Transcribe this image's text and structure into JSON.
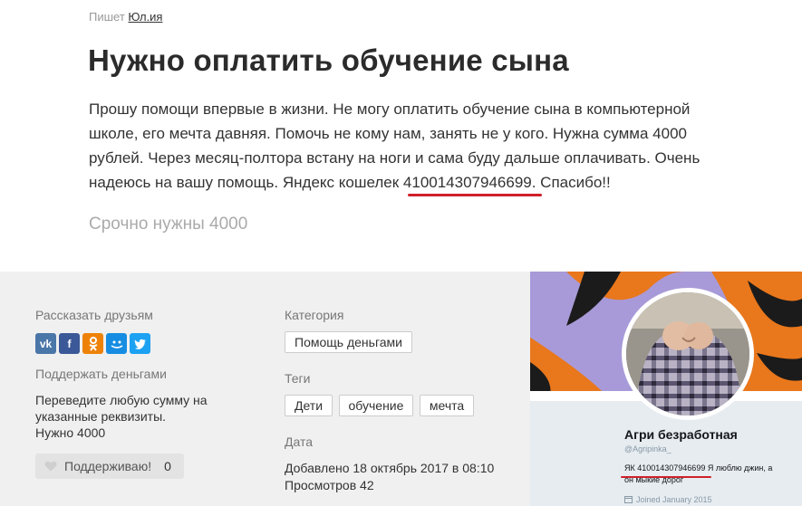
{
  "post": {
    "author_prefix": "Пишет",
    "author_name": "Юл.ия",
    "title": "Нужно оплатить обучение сына",
    "body_before_wallet": "Прошу помощи впервые в жизни. Не могу оплатить обучение сына в компьютерной школе, его мечта давняя. Помочь не кому нам, занять не у кого. Нужна сумма 4000 рублей. Через месяц-полтора встану на ноги и сама буду дальше оплачивать. Очень надеюсь на вашу помощь. Яндекс кошелек ",
    "wallet": "410014307946699",
    "body_after_wallet": ". Спасибо!!",
    "subtitle": "Срочно нужны 4000"
  },
  "sidebar_left": {
    "share_label": "Рассказать друзьям",
    "social": [
      {
        "name": "vk-icon",
        "glyph": "vk"
      },
      {
        "name": "facebook-icon",
        "glyph": "f"
      },
      {
        "name": "odnoklassniki-icon",
        "glyph": "ok"
      },
      {
        "name": "moimir-icon",
        "glyph": "@"
      },
      {
        "name": "twitter-icon",
        "glyph": "t"
      }
    ],
    "money_label": "Поддержать деньгами",
    "money_text_1": "Переведите любую сумму на",
    "money_text_2": "указанные реквизиты.",
    "money_text_3": "Нужно 4000",
    "support_button": "Поддерживаю!",
    "support_count": "0"
  },
  "sidebar_mid": {
    "category_label": "Категория",
    "category": "Помощь деньгами",
    "tags_label": "Теги",
    "tags": [
      "Дети",
      "обучение",
      "мечта"
    ],
    "date_label": "Дата",
    "added": "Добавлено 18 октябрь 2017 в 08:10",
    "views": "Просмотров 42"
  },
  "profile": {
    "name": "Агри безработная",
    "handle": "@Agripinka_",
    "bio_line1": "ЯК 410014307946699 Я люблю джин, а",
    "bio_line2": "он мыкие дорог",
    "joined": "Joined January 2015"
  }
}
